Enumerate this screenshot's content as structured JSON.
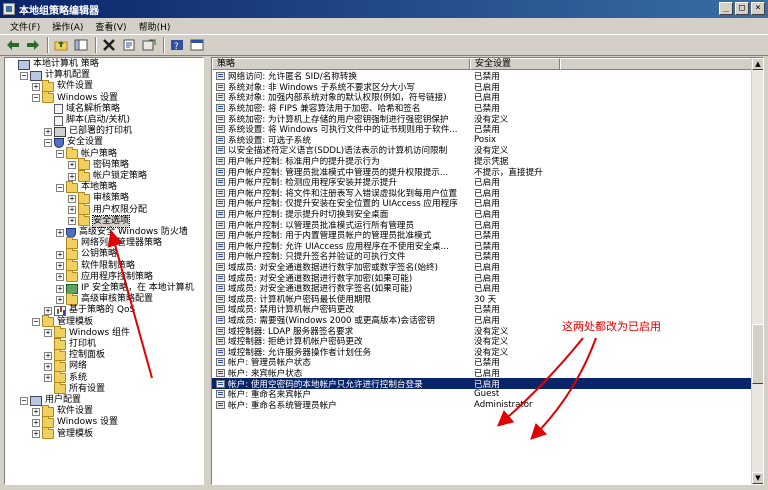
{
  "window": {
    "title": "本地组策略编辑器"
  },
  "menus": [
    "文件(F)",
    "操作(A)",
    "查看(V)",
    "帮助(H)"
  ],
  "toolbar": [
    "back-arrow-icon",
    "forward-arrow-icon",
    "up-folder-icon",
    "show-hide-tree-icon",
    "delete-icon",
    "properties-icon",
    "export-icon",
    "help-icon",
    "console-icon"
  ],
  "tree": [
    {
      "label": "本地计算机 策略",
      "level": 0,
      "icon": "computer",
      "exp": ""
    },
    {
      "label": "计算机配置",
      "level": 1,
      "icon": "computer",
      "exp": "−"
    },
    {
      "label": "软件设置",
      "level": 2,
      "icon": "folder",
      "exp": "+"
    },
    {
      "label": "Windows 设置",
      "level": 2,
      "icon": "folder",
      "exp": "−"
    },
    {
      "label": "域名解析策略",
      "level": 3,
      "icon": "doc",
      "exp": ""
    },
    {
      "label": "脚本(启动/关机)",
      "level": 3,
      "icon": "doc",
      "exp": ""
    },
    {
      "label": "已部署的打印机",
      "level": 3,
      "icon": "printer",
      "exp": "+"
    },
    {
      "label": "安全设置",
      "level": 3,
      "icon": "shield",
      "exp": "−"
    },
    {
      "label": "帐户策略",
      "level": 4,
      "icon": "folder",
      "exp": "−"
    },
    {
      "label": "密码策略",
      "level": 5,
      "icon": "folder",
      "exp": "+"
    },
    {
      "label": "帐户锁定策略",
      "level": 5,
      "icon": "folder",
      "exp": "+"
    },
    {
      "label": "本地策略",
      "level": 4,
      "icon": "folder",
      "exp": "−"
    },
    {
      "label": "审核策略",
      "level": 5,
      "icon": "folder",
      "exp": "+"
    },
    {
      "label": "用户权限分配",
      "level": 5,
      "icon": "folder",
      "exp": "+"
    },
    {
      "label": "安全选项",
      "level": 5,
      "icon": "folder",
      "exp": "+",
      "selected": true
    },
    {
      "label": "高级安全 Windows 防火墙",
      "level": 4,
      "icon": "shield",
      "exp": "+"
    },
    {
      "label": "网络列表管理器策略",
      "level": 4,
      "icon": "folder",
      "exp": ""
    },
    {
      "label": "公钥策略",
      "level": 4,
      "icon": "folder",
      "exp": "+"
    },
    {
      "label": "软件限制策略",
      "level": 4,
      "icon": "folder",
      "exp": "+"
    },
    {
      "label": "应用程序控制策略",
      "level": 4,
      "icon": "folder",
      "exp": "+"
    },
    {
      "label": "IP 安全策略，在 本地计算机",
      "level": 4,
      "icon": "network",
      "exp": "+"
    },
    {
      "label": "高级审核策略配置",
      "level": 4,
      "icon": "folder",
      "exp": "+"
    },
    {
      "label": "基于策略的 QoS",
      "level": 3,
      "icon": "chart",
      "exp": "+"
    },
    {
      "label": "管理模板",
      "level": 2,
      "icon": "folder",
      "exp": "−"
    },
    {
      "label": "Windows 组件",
      "level": 3,
      "icon": "folder",
      "exp": "+"
    },
    {
      "label": "打印机",
      "level": 3,
      "icon": "folder",
      "exp": ""
    },
    {
      "label": "控制面板",
      "level": 3,
      "icon": "folder",
      "exp": "+"
    },
    {
      "label": "网络",
      "level": 3,
      "icon": "folder",
      "exp": "+"
    },
    {
      "label": "系统",
      "level": 3,
      "icon": "folder",
      "exp": "+"
    },
    {
      "label": "所有设置",
      "level": 3,
      "icon": "folder",
      "exp": ""
    },
    {
      "label": "用户配置",
      "level": 1,
      "icon": "computer",
      "exp": "−"
    },
    {
      "label": "软件设置",
      "level": 2,
      "icon": "folder",
      "exp": "+"
    },
    {
      "label": "Windows 设置",
      "level": 2,
      "icon": "folder",
      "exp": "+"
    },
    {
      "label": "管理模板",
      "level": 2,
      "icon": "folder",
      "exp": "+"
    }
  ],
  "columns": {
    "policy": "策略",
    "setting": "安全设置"
  },
  "policies": [
    {
      "name": "网络访问: 允许匿名 SID/名称转换",
      "setting": "已禁用"
    },
    {
      "name": "系统对象: 非 Windows 子系统不要求区分大小写",
      "setting": "已启用"
    },
    {
      "name": "系统对象: 加强内部系统对象的默认权限(例如，符号链接)",
      "setting": "已启用"
    },
    {
      "name": "系统加密: 将 FIPS 兼容算法用于加密、哈希和签名",
      "setting": "已禁用"
    },
    {
      "name": "系统加密: 为计算机上存储的用户密钥强制进行强密钥保护",
      "setting": "没有定义"
    },
    {
      "name": "系统设置: 将 Windows 可执行文件中的证书规则用于软件...",
      "setting": "已禁用"
    },
    {
      "name": "系统设置: 可选子系统",
      "setting": "Posix"
    },
    {
      "name": "以安全描述符定义语言(SDDL)语法表示的计算机访问限制",
      "setting": "没有定义"
    },
    {
      "name": "用户帐户控制: 标准用户的提升提示行为",
      "setting": "提示凭据"
    },
    {
      "name": "用户帐户控制: 管理员批准模式中管理员的提升权限提示...",
      "setting": "不提示，直接提升"
    },
    {
      "name": "用户帐户控制: 检测应用程序安装并提示提升",
      "setting": "已启用"
    },
    {
      "name": "用户帐户控制: 将文件和注册表写入错误虚拟化到每用户位置",
      "setting": "已启用"
    },
    {
      "name": "用户帐户控制: 仅提升安装在安全位置的 UIAccess 应用程序",
      "setting": "已启用"
    },
    {
      "name": "用户帐户控制: 提示提升时切换到安全桌面",
      "setting": "已启用"
    },
    {
      "name": "用户帐户控制: 以管理员批准模式运行所有管理员",
      "setting": "已启用"
    },
    {
      "name": "用户帐户控制: 用于内置管理员帐户的管理员批准模式",
      "setting": "已禁用"
    },
    {
      "name": "用户帐户控制: 允许 UIAccess 应用程序在不使用安全桌...",
      "setting": "已禁用"
    },
    {
      "name": "用户帐户控制: 只提升签名并验证的可执行文件",
      "setting": "已禁用"
    },
    {
      "name": "域成员: 对安全通道数据进行数字加密或数字签名(始终)",
      "setting": "已启用"
    },
    {
      "name": "域成员: 对安全通道数据进行数字加密(如果可能)",
      "setting": "已启用"
    },
    {
      "name": "域成员: 对安全通道数据进行数字签名(如果可能)",
      "setting": "已启用"
    },
    {
      "name": "域成员: 计算机帐户密码最长使用期限",
      "setting": "30 天"
    },
    {
      "name": "域成员: 禁用计算机帐户密码更改",
      "setting": "已禁用"
    },
    {
      "name": "域成员: 需要强(Windows 2000 或更高版本)会话密钥",
      "setting": "已启用"
    },
    {
      "name": "域控制器: LDAP 服务器签名要求",
      "setting": "没有定义"
    },
    {
      "name": "域控制器: 拒绝计算机帐户密码更改",
      "setting": "没有定义"
    },
    {
      "name": "域控制器: 允许服务器操作者计划任务",
      "setting": "没有定义"
    },
    {
      "name": "帐户: 管理员帐户状态",
      "setting": "已禁用"
    },
    {
      "name": "帐户: 来宾帐户状态",
      "setting": "已启用"
    },
    {
      "name": "帐户: 使用空密码的本地帐户只允许进行控制台登录",
      "setting": "已启用",
      "selected": true
    },
    {
      "name": "帐户: 重命名来宾帐户",
      "setting": "Guest"
    },
    {
      "name": "帐户: 重命名系统管理员帐户",
      "setting": "Administrator"
    }
  ],
  "annotation": {
    "text": "这两处都改为已启用",
    "color": "#e00000"
  },
  "colors": {
    "selection": "#0a246a",
    "annotation": "#e00000"
  }
}
